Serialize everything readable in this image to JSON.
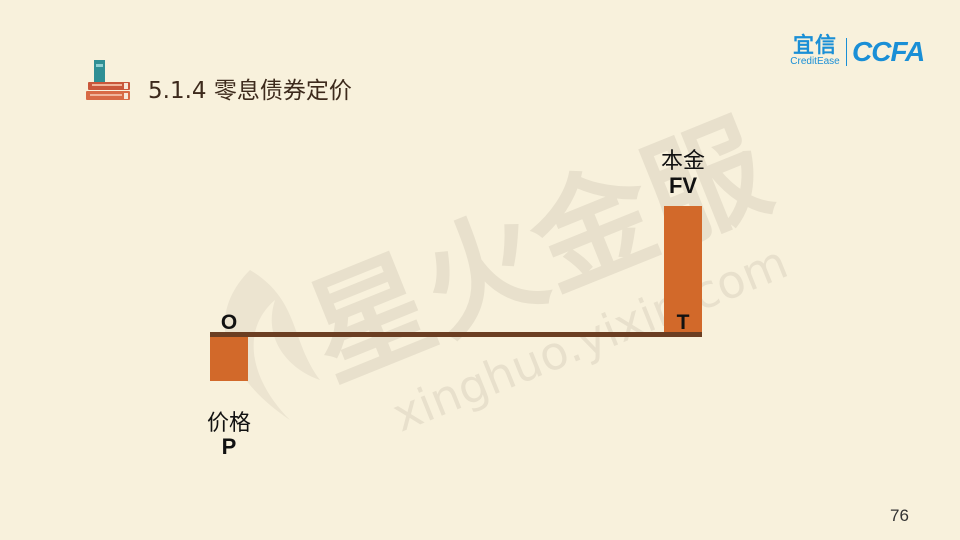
{
  "header": {
    "title": "5.1.4 零息债券定价",
    "icon": "stacked-books-icon"
  },
  "logos": {
    "yixin_cn": "宜信",
    "yixin_en": "CreditEase",
    "ccfa": "CCFA",
    "brand_color": "#1a8fd6"
  },
  "watermark": {
    "cn": "星火金服",
    "url": "xinghuo.yixin.com"
  },
  "diagram": {
    "origin_label": "O",
    "maturity_label": "T",
    "principal_label_cn": "本金",
    "principal_label_sym": "FV",
    "price_label_cn": "价格",
    "price_label_sym": "P",
    "bar_color": "#d2692a",
    "timeline_color": "#6b3e22"
  },
  "footer": {
    "page_number": "76"
  }
}
